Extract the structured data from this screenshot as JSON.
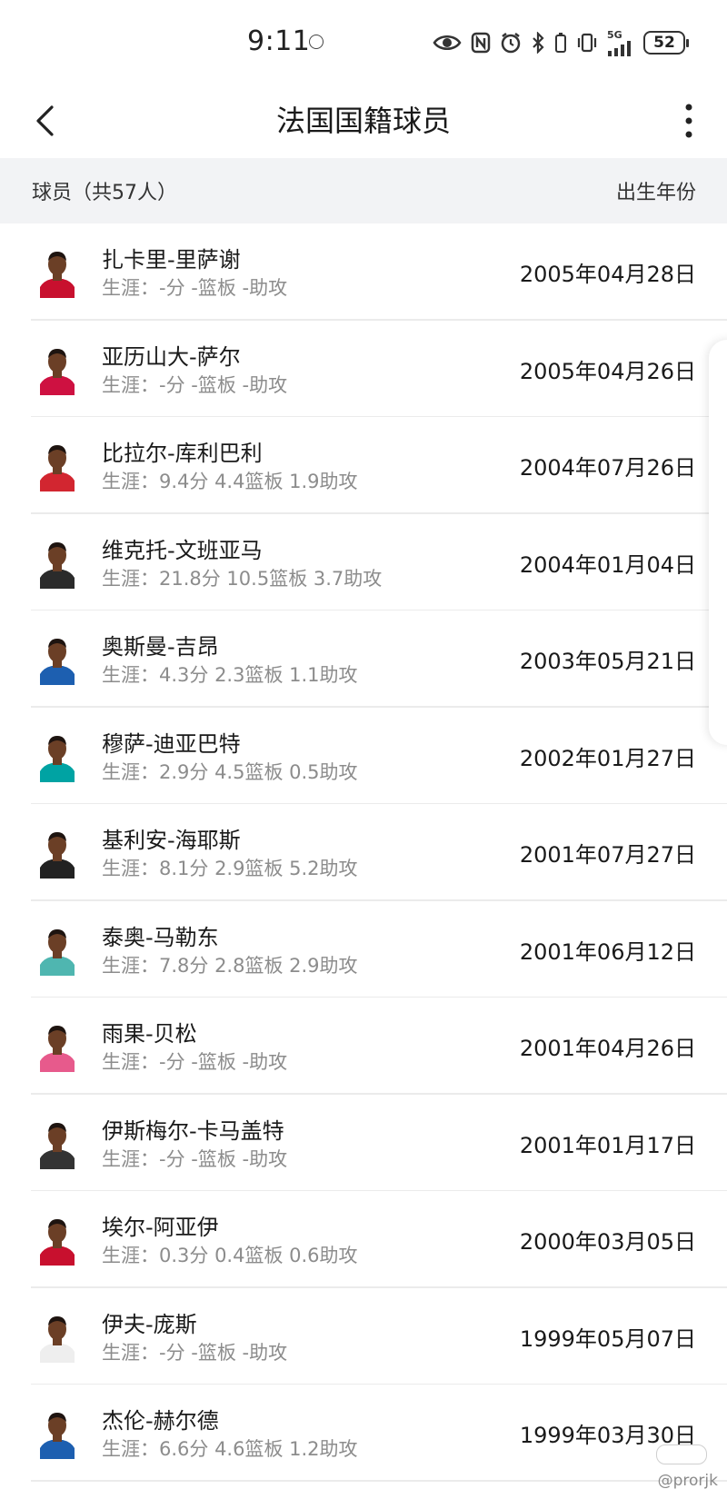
{
  "status_bar": {
    "time": "9:11",
    "battery": "52",
    "network": "5G",
    "icons": [
      "eye-icon",
      "nfc-icon",
      "alarm-icon",
      "bluetooth-icon",
      "vibrate-icon",
      "signal-icon",
      "battery-icon"
    ]
  },
  "nav": {
    "title": "法国国籍球员",
    "back_icon": "chevron-left-icon",
    "more_icon": "more-vertical-icon"
  },
  "header": {
    "left": "球员（共57人）",
    "right": "出生年份"
  },
  "players": [
    {
      "name": "扎卡里-里萨谢",
      "career": "生涯：-分 -篮板 -助攻",
      "birth": "2005年04月28日",
      "jersey": "#c8102e"
    },
    {
      "name": "亚历山大-萨尔",
      "career": "生涯：-分 -篮板 -助攻",
      "birth": "2005年04月26日",
      "jersey": "#ce1141"
    },
    {
      "name": "比拉尔-库利巴利",
      "career": "生涯：9.4分 4.4篮板 1.9助攻",
      "birth": "2004年07月26日",
      "jersey": "#d22630"
    },
    {
      "name": "维克托-文班亚马",
      "career": "生涯：21.8分 10.5篮板 3.7助攻",
      "birth": "2004年01月04日",
      "jersey": "#2b2b2b"
    },
    {
      "name": "奥斯曼-吉昂",
      "career": "生涯：4.3分 2.3篮板 1.1助攻",
      "birth": "2003年05月21日",
      "jersey": "#1d5fb0"
    },
    {
      "name": "穆萨-迪亚巴特",
      "career": "生涯：2.9分 4.5篮板 0.5助攻",
      "birth": "2002年01月27日",
      "jersey": "#00a3a3"
    },
    {
      "name": "基利安-海耶斯",
      "career": "生涯：8.1分 2.9篮板 5.2助攻",
      "birth": "2001年07月27日",
      "jersey": "#222222"
    },
    {
      "name": "泰奥-马勒东",
      "career": "生涯：7.8分 2.8篮板 2.9助攻",
      "birth": "2001年06月12日",
      "jersey": "#4fb6b0"
    },
    {
      "name": "雨果-贝松",
      "career": "生涯：-分 -篮板 -助攻",
      "birth": "2001年04月26日",
      "jersey": "#e75a8c"
    },
    {
      "name": "伊斯梅尔-卡马盖特",
      "career": "生涯：-分 -篮板 -助攻",
      "birth": "2001年01月17日",
      "jersey": "#333333"
    },
    {
      "name": "埃尔-阿亚伊",
      "career": "生涯：0.3分 0.4篮板 0.6助攻",
      "birth": "2000年03月05日",
      "jersey": "#c8102e"
    },
    {
      "name": "伊夫-庞斯",
      "career": "生涯：-分 -篮板 -助攻",
      "birth": "1999年05月07日",
      "jersey": "#eeeeee"
    },
    {
      "name": "杰伦-赫尔德",
      "career": "生涯：6.6分 4.6篮板 1.2助攻",
      "birth": "1999年03月30日",
      "jersey": "#1d5fb0"
    }
  ],
  "watermark": "@prorjk"
}
